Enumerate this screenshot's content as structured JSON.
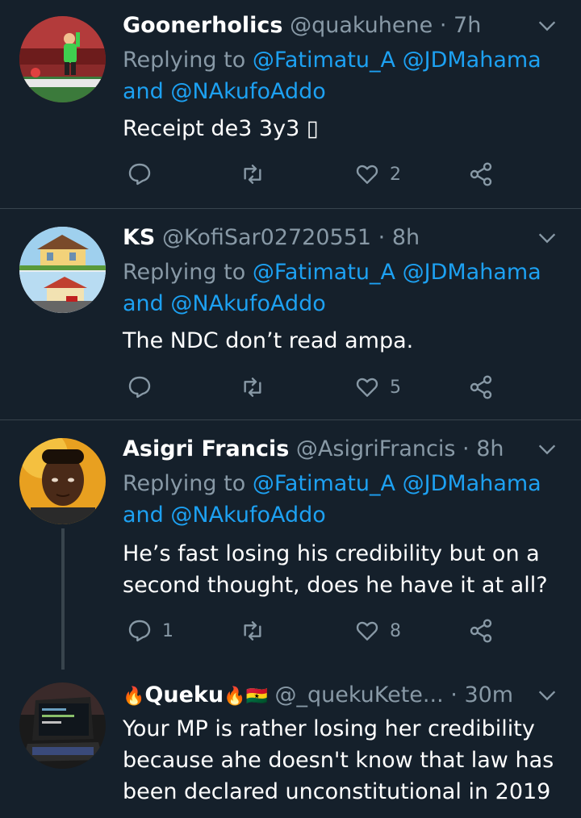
{
  "tweets": [
    {
      "name": "Goonerholics",
      "handle": "@quakuhene",
      "dot": "·",
      "time": "7h",
      "replying_prefix": "Replying to",
      "mention1": "@Fatimatu_A",
      "mention2": "@JDMahama",
      "and": "and",
      "mention3": "@NAkufoAddo",
      "text": "Receipt de3 3y3 ▯",
      "replies": "",
      "retweets": "",
      "likes": "2"
    },
    {
      "name": "KS",
      "handle": "@KofiSar02720551",
      "dot": "·",
      "time": "8h",
      "replying_prefix": "Replying to",
      "mention1": "@Fatimatu_A",
      "mention2": "@JDMahama",
      "and": "and",
      "mention3": "@NAkufoAddo",
      "text": "The NDC don’t read ampa.",
      "replies": "",
      "retweets": "",
      "likes": "5"
    },
    {
      "name": "Asigri Francis",
      "handle": "@AsigriFrancis",
      "dot": "·",
      "time": "8h",
      "replying_prefix": "Replying to",
      "mention1": "@Fatimatu_A",
      "mention2": "@JDMahama",
      "and": "and",
      "mention3": "@NAkufoAddo",
      "text_line1": "He’s fast losing his credibility but on a",
      "text_line2": "second thought, does he have it at all?",
      "replies": "1",
      "retweets": "",
      "likes": "8"
    },
    {
      "name_emoji_left": "🔥",
      "name": "Queku",
      "name_emoji_right": "🔥🇬🇭",
      "handle": "@_quekuKete...",
      "dot": "·",
      "time": "30m",
      "text_line1": "Your MP is rather losing her credibility",
      "text_line2": "because ahe doesn't know that law has",
      "text_line3": "been declared unconstitutional in 2019"
    }
  ],
  "colors": {
    "background": "#15202b",
    "secondary_text": "#8899a6",
    "link": "#1da1f2",
    "divider": "#38444d"
  },
  "icons": [
    "chevron-down-icon",
    "reply-icon",
    "retweet-icon",
    "like-icon",
    "share-icon"
  ]
}
